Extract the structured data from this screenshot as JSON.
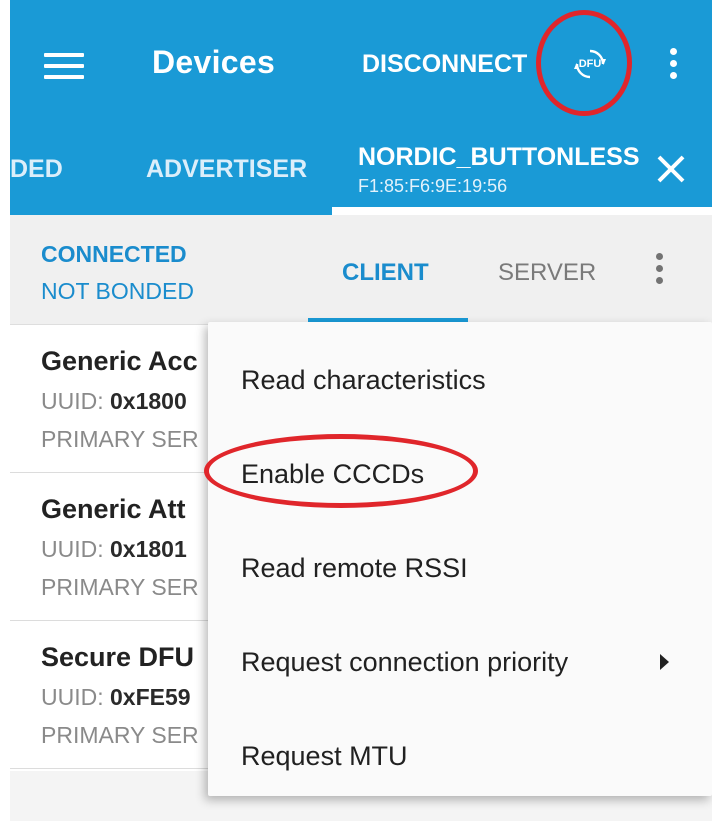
{
  "toolbar": {
    "title": "Devices",
    "disconnect_label": "DISCONNECT",
    "dfu_label": "DFU"
  },
  "tabs": [
    {
      "label": "DED"
    },
    {
      "label": "ADVERTISER"
    },
    {
      "label": "NORDIC_BUTTONLESS",
      "address": "F1:85:F6:9E:19:56"
    }
  ],
  "connection": {
    "state": "CONNECTED",
    "bond": "NOT BONDED"
  },
  "subtabs": [
    {
      "label": "CLIENT"
    },
    {
      "label": "SERVER"
    }
  ],
  "services": [
    {
      "name": "Generic Acc",
      "uuid_label": "UUID:",
      "uuid": "0x1800",
      "type": "PRIMARY SER"
    },
    {
      "name": "Generic Att",
      "uuid_label": "UUID:",
      "uuid": "0x1801",
      "type": "PRIMARY SER"
    },
    {
      "name": "Secure DFU",
      "uuid_label": "UUID:",
      "uuid": "0xFE59",
      "type": "PRIMARY SER"
    }
  ],
  "menu": {
    "items": [
      {
        "label": "Read characteristics"
      },
      {
        "label": "Enable CCCDs"
      },
      {
        "label": "Read remote RSSI"
      },
      {
        "label": "Request connection priority"
      },
      {
        "label": "Request MTU"
      }
    ]
  },
  "colors": {
    "app_bar": "#1a9ad6",
    "accent": "#1a8ccd",
    "highlight_ring": "#e0262b"
  }
}
